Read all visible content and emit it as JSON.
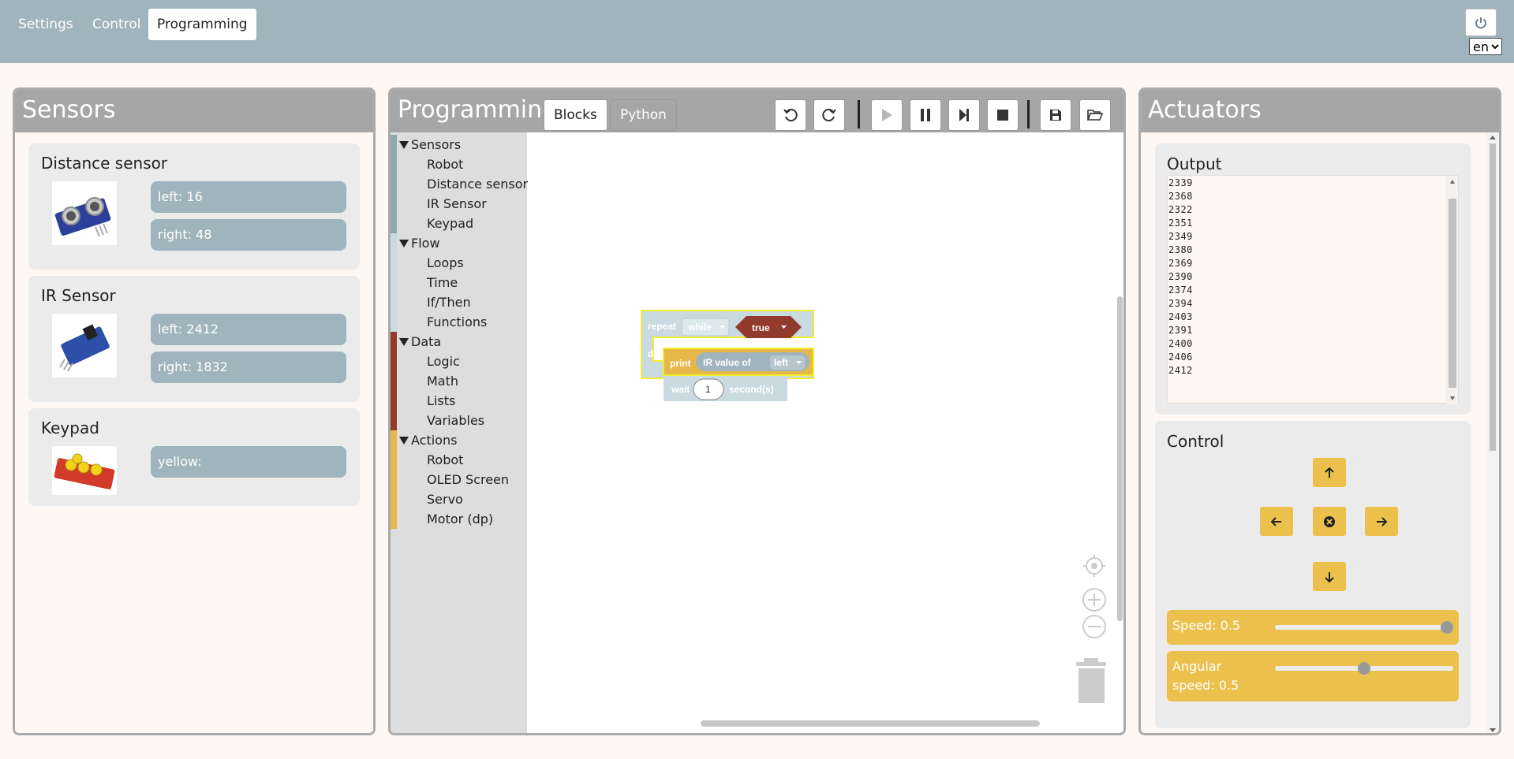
{
  "tabs": [
    {
      "label": "Settings"
    },
    {
      "label": "Control"
    },
    {
      "label": "Programming"
    }
  ],
  "language": "en",
  "sensors_panel": {
    "title": "Sensors",
    "cards": [
      {
        "name": "Distance sensor",
        "values": [
          "left: 16",
          "right: 48"
        ]
      },
      {
        "name": "IR Sensor",
        "values": [
          "left: 2412",
          "right: 1832"
        ]
      },
      {
        "name": "Keypad",
        "values": [
          "yellow:"
        ]
      }
    ]
  },
  "programming_panel": {
    "title": "Programming",
    "modes": [
      "Blocks",
      "Python"
    ],
    "active_mode": "Blocks",
    "toolbox": [
      {
        "label": "Sensors",
        "header": true,
        "color": "#8fa8b0"
      },
      {
        "label": "Robot",
        "header": false,
        "color": "#8fa8b0"
      },
      {
        "label": "Distance sensor",
        "header": false,
        "color": "#8fa8b0"
      },
      {
        "label": "IR Sensor",
        "header": false,
        "color": "#8fa8b0"
      },
      {
        "label": "Keypad",
        "header": false,
        "color": "#8fa8b0"
      },
      {
        "label": "Flow",
        "header": true,
        "color": "#c9dae0"
      },
      {
        "label": "Loops",
        "header": false,
        "color": "#c9dae0"
      },
      {
        "label": "Time",
        "header": false,
        "color": "#c9dae0"
      },
      {
        "label": "If/Then",
        "header": false,
        "color": "#c9dae0"
      },
      {
        "label": "Functions",
        "header": false,
        "color": "#c9dae0"
      },
      {
        "label": "Data",
        "header": true,
        "color": "#923a2b"
      },
      {
        "label": "Logic",
        "header": false,
        "color": "#923a2b"
      },
      {
        "label": "Math",
        "header": false,
        "color": "#923a2b"
      },
      {
        "label": "Lists",
        "header": false,
        "color": "#923a2b"
      },
      {
        "label": "Variables",
        "header": false,
        "color": "#923a2b"
      },
      {
        "label": "Actions",
        "header": true,
        "color": "#e6b84a"
      },
      {
        "label": "Robot",
        "header": false,
        "color": "#e6b84a"
      },
      {
        "label": "OLED Screen",
        "header": false,
        "color": "#e6b84a"
      },
      {
        "label": "Servo",
        "header": false,
        "color": "#e6b84a"
      },
      {
        "label": "Motor (dp)",
        "header": false,
        "color": "#e6b84a"
      }
    ],
    "blocks": {
      "repeat_label": "repeat",
      "repeat_mode": "while",
      "condition": "true",
      "do_label": "do",
      "print_label": "print",
      "ir_label": "IR value of",
      "ir_side": "left",
      "wait_label": "wait",
      "wait_value": "1",
      "wait_unit": "second(s)"
    }
  },
  "actuators_panel": {
    "title": "Actuators",
    "output": {
      "title": "Output",
      "lines": [
        "2339",
        "2368",
        "2322",
        "2351",
        "2349",
        "2380",
        "2369",
        "2390",
        "2374",
        "2394",
        "2403",
        "2391",
        "2400",
        "2406",
        "2412"
      ]
    },
    "control": {
      "title": "Control",
      "speed": {
        "label": "Speed: 0.5",
        "value": 1.0
      },
      "angular": {
        "label_line1": "Angular",
        "label_line2": "speed: 0.5",
        "value": 0.5
      }
    }
  },
  "colors": {
    "topbar": "#9fb4bc",
    "sensor_value": "#9fb4bc",
    "control_accent": "#ecc04d",
    "data_block": "#923a2b",
    "loop_block": "#c9dae0",
    "action_block": "#e6b84a"
  }
}
